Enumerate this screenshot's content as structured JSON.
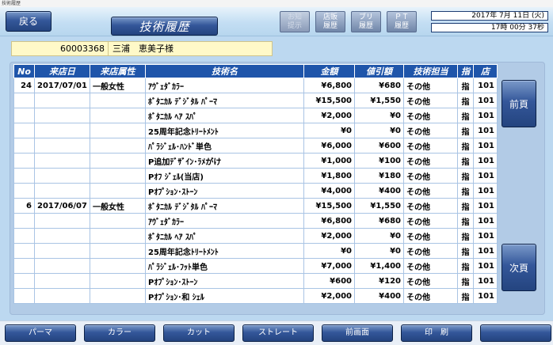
{
  "window_title": "技術履歴",
  "header": {
    "back_label": "戻る",
    "title": "技術履歴",
    "buttons": [
      "お知\n提示",
      "店販\n履歴",
      "ブリ\n履歴",
      "ＰＴ\n履歴"
    ],
    "date": "2017年 7月 11日 (火)",
    "time": "17時 00分 37秒"
  },
  "customer": {
    "number": "60003368",
    "name": "三浦　恵美子様"
  },
  "table": {
    "headers": [
      "No",
      "来店日",
      "来店属性",
      "技術名",
      "金額",
      "値引額",
      "技術担当",
      "指",
      "店"
    ],
    "rows": [
      [
        "24",
        "2017/07/01",
        "一般女性",
        "ｱｳﾞｪﾀﾞｶﾗｰ",
        "¥6,800",
        "¥680",
        "その他",
        "指",
        "101"
      ],
      [
        "",
        "",
        "",
        "ﾎﾞﾀﾆｶﾙ ﾃﾞｼﾞﾀﾙ ﾊﾟｰﾏ",
        "¥15,500",
        "¥1,550",
        "その他",
        "指",
        "101"
      ],
      [
        "",
        "",
        "",
        "ﾎﾞﾀﾆｶﾙ ﾍｱ ｽﾊﾟ",
        "¥2,000",
        "¥0",
        "その他",
        "指",
        "101"
      ],
      [
        "",
        "",
        "",
        "25周年記念ﾄﾘｰﾄﾒﾝﾄ",
        "¥0",
        "¥0",
        "その他",
        "指",
        "101"
      ],
      [
        "",
        "",
        "",
        "ﾊﾟﾗｼﾞｪﾙ･ﾊﾝﾄﾞ単色",
        "¥6,000",
        "¥600",
        "その他",
        "指",
        "101"
      ],
      [
        "",
        "",
        "",
        "P追加ﾃﾞｻﾞｲﾝ･ﾗﾒがけ",
        "¥1,000",
        "¥100",
        "その他",
        "指",
        "101"
      ],
      [
        "",
        "",
        "",
        "Pｵﾌ ｼﾞｪﾙ(当店)",
        "¥1,800",
        "¥180",
        "その他",
        "指",
        "101"
      ],
      [
        "",
        "",
        "",
        "Pｵﾌﾟｼｮﾝ･ｽﾄｰﾝ",
        "¥4,000",
        "¥400",
        "その他",
        "指",
        "101"
      ],
      [
        "6",
        "2017/06/07",
        "一般女性",
        "ﾎﾞﾀﾆｶﾙ ﾃﾞｼﾞﾀﾙ ﾊﾟｰﾏ",
        "¥15,500",
        "¥1,550",
        "その他",
        "指",
        "101"
      ],
      [
        "",
        "",
        "",
        "ｱｳﾞｪﾀﾞｶﾗｰ",
        "¥6,800",
        "¥680",
        "その他",
        "指",
        "101"
      ],
      [
        "",
        "",
        "",
        "ﾎﾞﾀﾆｶﾙ ﾍｱ ｽﾊﾟ",
        "¥2,000",
        "¥0",
        "その他",
        "指",
        "101"
      ],
      [
        "",
        "",
        "",
        "25周年記念ﾄﾘｰﾄﾒﾝﾄ",
        "¥0",
        "¥0",
        "その他",
        "指",
        "101"
      ],
      [
        "",
        "",
        "",
        "ﾊﾟﾗｼﾞｪﾙ･ﾌｯﾄ単色",
        "¥7,000",
        "¥1,400",
        "その他",
        "指",
        "101"
      ],
      [
        "",
        "",
        "",
        "Pｵﾌﾟｼｮﾝ･ｽﾄｰﾝ",
        "¥600",
        "¥120",
        "その他",
        "指",
        "101"
      ],
      [
        "",
        "",
        "",
        "Pｵﾌﾟｼｮﾝ･和 ｼｪﾙ",
        "¥2,000",
        "¥400",
        "その他",
        "指",
        "101"
      ]
    ]
  },
  "side": {
    "prev_label": "前頁",
    "next_label": "次頁"
  },
  "footer": {
    "buttons": [
      "パーマ",
      "カラー",
      "カット",
      "ストレート",
      "前画面",
      "印　刷",
      ""
    ]
  }
}
